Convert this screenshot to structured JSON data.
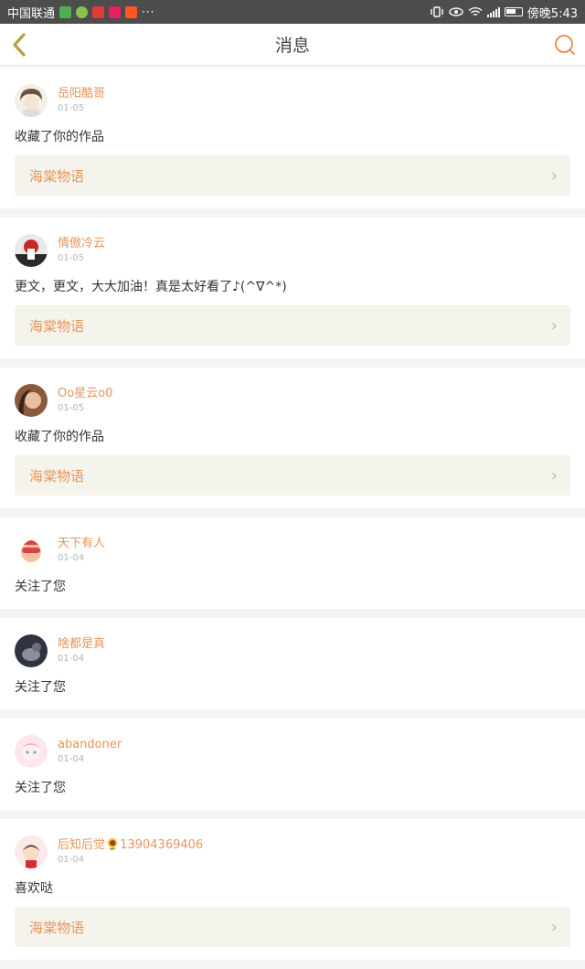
{
  "status_bar": {
    "carrier": "中国联通",
    "time": "傍晚5:43",
    "dots": "···"
  },
  "header": {
    "title": "消息",
    "back_icon": "chevron-left-icon",
    "search_icon": "search-icon"
  },
  "colors": {
    "accent": "#e8945a",
    "back_icon": "#b8a040",
    "link_bg": "#f5f4ec"
  },
  "messages": [
    {
      "user": "岳阳酷哥",
      "date": "01-05",
      "text": "收藏了你的作品",
      "work": "海棠物语"
    },
    {
      "user": "情傲冷云",
      "date": "01-05",
      "text": "更文，更文，大大加油！真是太好看了♪(^∇^*)",
      "work": "海棠物语"
    },
    {
      "user": "Oo星云o0",
      "date": "01-05",
      "text": "收藏了你的作品",
      "work": "海棠物语"
    },
    {
      "user": "天下有人",
      "date": "01-04",
      "text": "关注了您"
    },
    {
      "user": "啥都是真",
      "date": "01-04",
      "text": "关注了您"
    },
    {
      "user": "abandoner",
      "date": "01-04",
      "text": "关注了您"
    },
    {
      "user": "后知后觉🌻13904369406",
      "date": "01-04",
      "text": "喜欢哒",
      "work": "海棠物语"
    }
  ]
}
